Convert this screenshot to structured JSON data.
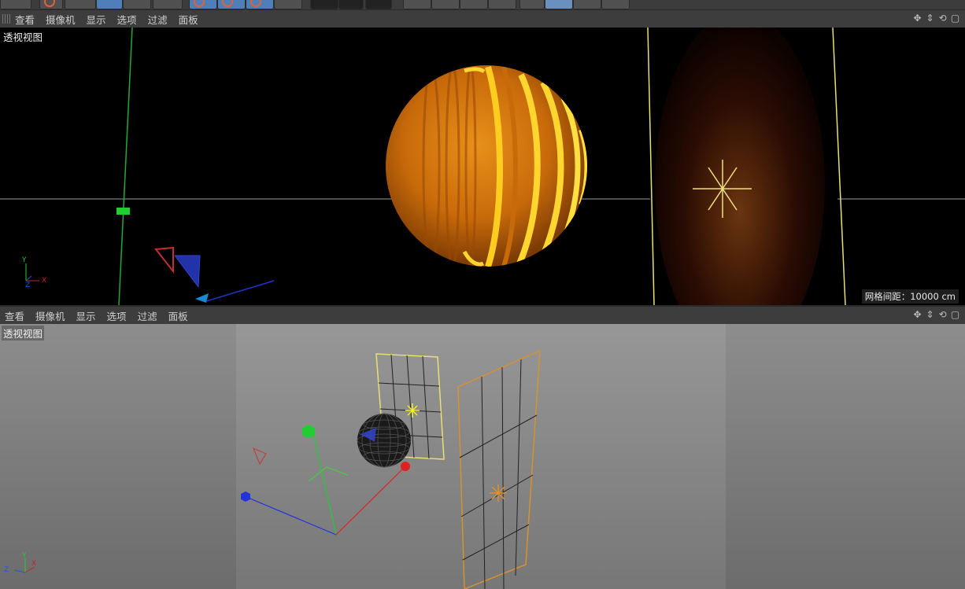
{
  "top_view": {
    "menu": [
      "查看",
      "摄像机",
      "显示",
      "选项",
      "过滤",
      "面板"
    ],
    "label": "透视视图",
    "grid_spacing": "网格间距：10000 cm",
    "axis_labels": {
      "y": "Y",
      "x": "X",
      "z": "Z"
    }
  },
  "bottom_view": {
    "menu": [
      "查看",
      "摄像机",
      "显示",
      "选项",
      "过滤",
      "面板"
    ],
    "label": "透视视图",
    "axis_labels": {
      "y": "Y",
      "x": "X",
      "z": "Z"
    }
  },
  "toolbar": {
    "icons": [
      "undo-icon",
      "keyframe-icon",
      "select-icon",
      "move-icon",
      "scale-icon",
      "rotate-x-icon",
      "rotate-y-icon",
      "rotate-z-icon",
      "transform-icon",
      "play-icon",
      "play-forward-icon",
      "record-icon",
      "cube-icon",
      "pen-icon",
      "subdivide-icon",
      "deformer-icon",
      "scene-icon",
      "floor-icon",
      "camera-icon",
      "light-icon"
    ]
  },
  "colors": {
    "sphere_orange": "#d97a10",
    "highlight_yellow": "#ffd020",
    "wire_yellow": "#e0d060",
    "wire_orange": "#d89030",
    "axis_green": "#22cc33",
    "axis_red": "#dd2222",
    "axis_blue": "#2233dd"
  }
}
